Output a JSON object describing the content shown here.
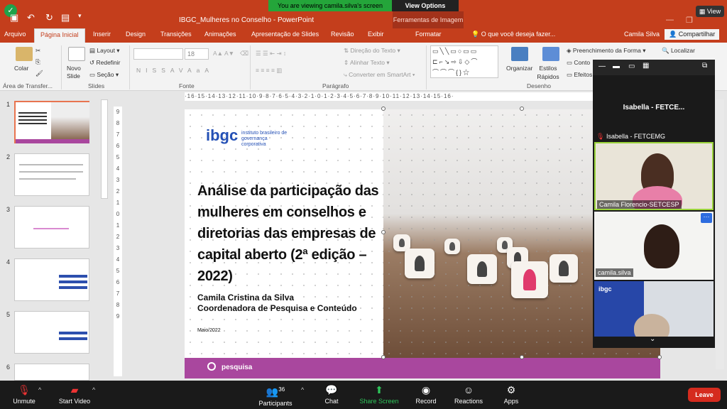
{
  "zoom": {
    "share_banner": "You are viewing camila.silva's screen",
    "view_options": "View Options",
    "view_button": "View",
    "toolbar": [
      {
        "label": "Unmute",
        "icon": "muted-mic-icon"
      },
      {
        "label": "Start Video",
        "icon": "video-off-icon"
      },
      {
        "label": "Participants",
        "icon": "participants-icon",
        "count": "36"
      },
      {
        "label": "Chat",
        "icon": "chat-icon"
      },
      {
        "label": "Share Screen",
        "icon": "share-screen-icon"
      },
      {
        "label": "Record",
        "icon": "record-icon"
      },
      {
        "label": "Reactions",
        "icon": "reactions-icon"
      },
      {
        "label": "Apps",
        "icon": "apps-icon"
      }
    ],
    "leave": "Leave",
    "panel": {
      "active_speaker": "Isabella - FETCE...",
      "speaker_label": "Isabella - FETCEMG",
      "participants": [
        {
          "name": "Camila Florencio-SETCESP"
        },
        {
          "name": "camila.silva"
        },
        {
          "name": "ibgc"
        }
      ]
    }
  },
  "ppt": {
    "window_title": "IBGC_Mulheres no Conselho - PowerPoint",
    "context_tab": "Ferramentas de Imagem",
    "user": "Camila Silva",
    "share": "Compartilhar",
    "tell_me": "O que você deseja fazer...",
    "tabs": [
      "Arquivo",
      "Página Inicial",
      "Inserir",
      "Design",
      "Transições",
      "Animações",
      "Apresentação de Slides",
      "Revisão",
      "Exibir",
      "Formatar"
    ],
    "ribbon": {
      "colar": "Colar",
      "novo_slide": "Novo Slide",
      "layout": "Layout",
      "redefinir": "Redefinir",
      "secao": "Seção",
      "font_size": "18",
      "direcao": "Direção do Texto",
      "alinhar": "Alinhar Texto",
      "converter": "Converter em SmartArt",
      "organizar": "Organizar",
      "estilos": "Estilos Rápidos",
      "preenchimento": "Preenchimento da Forma",
      "contorno": "Conto",
      "efeitos": "Efeitos",
      "localizar": "Localizar",
      "font_buttons": [
        "N",
        "I",
        "S",
        "S",
        "AV",
        "Aa",
        "A"
      ],
      "groups": [
        "Área de Transfer...",
        "Slides",
        "Fonte",
        "Parágrafo",
        "Desenho"
      ]
    },
    "ruler_text": "·16·15·14·13·12·11·10·9·8·7·6·5·4·3·2·1·0·1·2·3·4·5·6·7·8·9·10·11·12·13·14·15·16·",
    "vruler_text": [
      "9",
      "8",
      "7",
      "6",
      "5",
      "4",
      "3",
      "2",
      "1",
      "0",
      "1",
      "2",
      "3",
      "4",
      "5",
      "6",
      "7",
      "8",
      "9"
    ],
    "thumb_numbers": [
      "1",
      "2",
      "3",
      "4",
      "5",
      "6"
    ],
    "slide": {
      "logo_word": "ibgc",
      "logo_sub": "instituto brasileiro de governança corporativa",
      "title": "Análise da participação das mulheres em conselhos e diretorias das empresas de capital aberto (2ª edição – 2022)",
      "author": "Camila Cristina da Silva",
      "role": "Coordenadora de Pesquisa e Conteúdo",
      "date": "Maio/2022",
      "footer": "pesquisa"
    }
  }
}
